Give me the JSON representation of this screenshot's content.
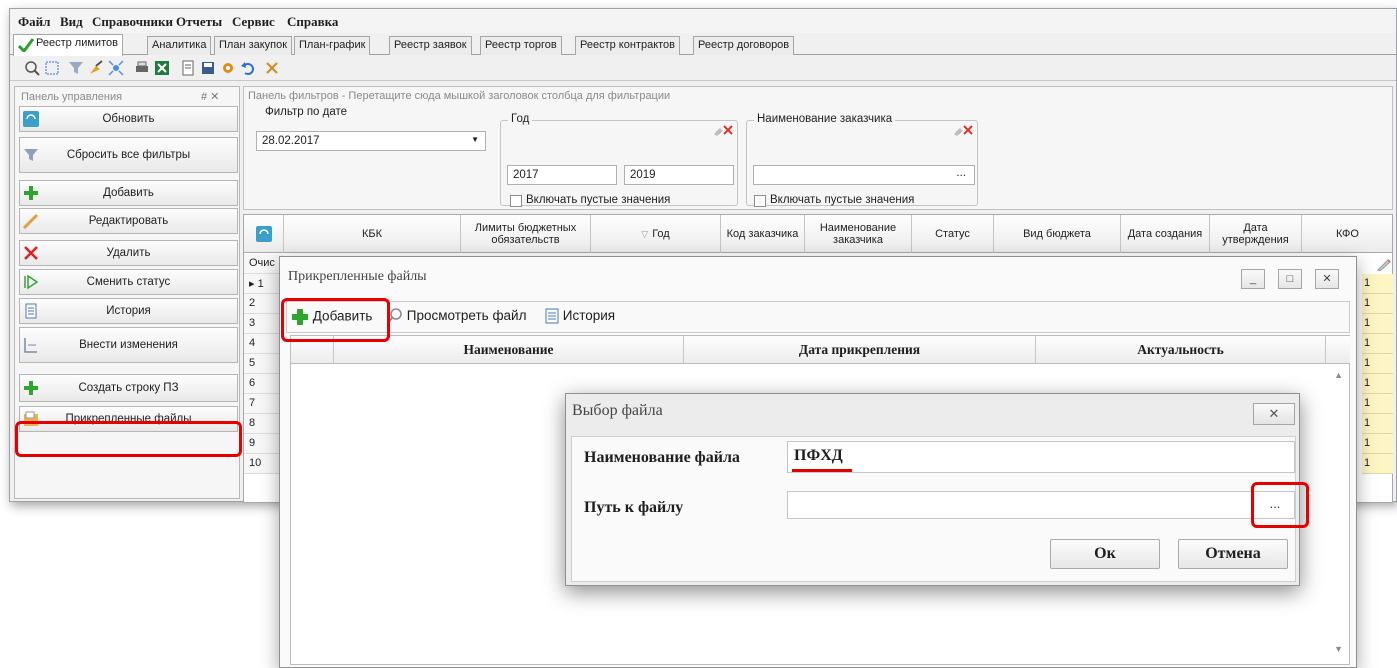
{
  "menu": [
    "Файл",
    "Вид",
    "Справочники",
    "Отчеты",
    "Сервис",
    "Справка"
  ],
  "tabs": [
    "Реестр лимитов",
    "Аналитика",
    "План закупок",
    "План-график",
    "Реестр заявок",
    "Реестр торгов",
    "Реестр контрактов",
    "Реестр договоров"
  ],
  "toolbar_icons": [
    "search-icon",
    "select-icon",
    "filter-icon",
    "brush-icon",
    "expand-icon",
    "print-icon",
    "excel-icon",
    "document-icon",
    "save-icon",
    "settings-icon",
    "undo-icon",
    "cut-icon"
  ],
  "left_panel": {
    "title": "Панель управления",
    "pin": "# ✕",
    "buttons": [
      {
        "label": "Обновить",
        "icon": "refresh-icon"
      },
      {
        "label": "Сбросить все фильтры",
        "icon": "funnel-icon"
      },
      {
        "label": "Добавить",
        "icon": "plus-icon"
      },
      {
        "label": "Редактировать",
        "icon": "pencil-icon"
      },
      {
        "label": "Удалить",
        "icon": "delete-icon"
      },
      {
        "label": "Сменить статус",
        "icon": "status-icon"
      },
      {
        "label": "История",
        "icon": "history-icon"
      },
      {
        "label": "Внести изменения",
        "icon": "changes-icon"
      },
      {
        "label": "Создать строку ПЗ",
        "icon": "plus-icon"
      },
      {
        "label": "Прикрепленные файлы",
        "icon": "attachments-icon"
      }
    ]
  },
  "filter_panel": {
    "title": "Панель фильтров - Перетащите сюда мышкой заголовок столбца для фильтрации",
    "date_filter": {
      "label": "Фильтр по дате",
      "value": "28.02.2017"
    },
    "year": {
      "label": "Год",
      "from": "2017",
      "to": "2019",
      "include_empty": "Включать пустые значения"
    },
    "customer": {
      "label": "Наименование заказчика",
      "value": "",
      "ellipsis": "...",
      "include_empty": "Включать пустые значения"
    }
  },
  "grid": {
    "columns": [
      "КБК",
      "Лимиты бюджетных обязательств",
      "Год",
      "Код заказчика",
      "Наименование заказчика",
      "Статус",
      "Вид бюджета",
      "Дата создания",
      "Дата утверждения",
      "КФО"
    ],
    "filter_row_label": "Очис",
    "row_numbers": [
      "1",
      "2",
      "3",
      "4",
      "5",
      "6",
      "7",
      "8",
      "9",
      "10"
    ],
    "kfo_values": [
      "1",
      "1",
      "1",
      "1",
      "1",
      "1",
      "1",
      "1",
      "1",
      "1"
    ]
  },
  "attached_dialog": {
    "title": "Прикрепленные файлы",
    "window_controls": [
      "_",
      "□",
      "✕"
    ],
    "toolbar": {
      "add": "Добавить",
      "view": "Просмотреть файл",
      "history": "История"
    },
    "columns": [
      "Наименование",
      "Дата прикрепления",
      "Актуальность"
    ]
  },
  "file_dialog": {
    "title": "Выбор файла",
    "close": "✕",
    "name_label": "Наименование файла",
    "name_value": "ПФХД",
    "path_label": "Путь к файлу",
    "path_value": "",
    "browse": "...",
    "ok": "Ок",
    "cancel": "Отмена"
  },
  "colors": {
    "highlight": "#e60000",
    "accent_green": "#2e9d2e",
    "kfo_cell": "#fdf6c4"
  }
}
